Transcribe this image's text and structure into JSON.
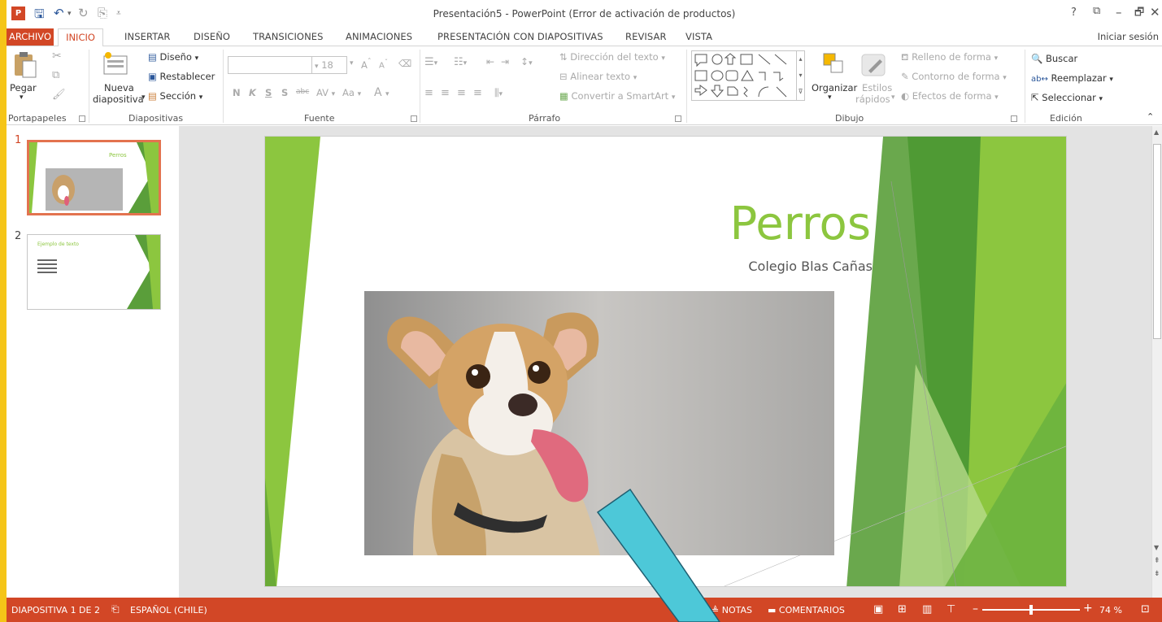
{
  "window": {
    "title": "Presentación5 - PowerPoint (Error de activación de productos)",
    "app_badge": "P",
    "controls": [
      "?",
      "⧉",
      "–",
      "🗗",
      "✕"
    ]
  },
  "tabs": {
    "file": "ARCHIVO",
    "active": "INICIO",
    "items": [
      "INSERTAR",
      "DISEÑO",
      "TRANSICIONES",
      "ANIMACIONES",
      "PRESENTACIÓN CON DIAPOSITIVAS",
      "REVISAR",
      "VISTA"
    ],
    "signin": "Iniciar sesión"
  },
  "ribbon": {
    "clipboard": {
      "paste": "Pegar",
      "label": "Portapapeles"
    },
    "slides": {
      "new_slide_1": "Nueva",
      "new_slide_2": "diapositiva",
      "layout": "Diseño",
      "reset": "Restablecer",
      "section": "Sección",
      "label": "Diapositivas"
    },
    "font": {
      "size": "18",
      "bold": "N",
      "italic": "K",
      "underline": "S",
      "shadow": "S",
      "strike": "abc",
      "spacing": "AV",
      "case": "Aa",
      "color": "A",
      "grow": "A",
      "shrink": "A",
      "label": "Fuente"
    },
    "paragraph": {
      "direction": "Dirección del texto",
      "align": "Alinear texto",
      "smartart": "Convertir a SmartArt",
      "label": "Párrafo"
    },
    "drawing": {
      "arrange": "Organizar",
      "styles_1": "Estilos",
      "styles_2": "rápidos",
      "fill": "Relleno de forma",
      "outline": "Contorno de forma",
      "effects": "Efectos de forma",
      "label": "Dibujo"
    },
    "editing": {
      "find": "Buscar",
      "replace": "Reemplazar",
      "select": "Seleccionar",
      "label": "Edición"
    }
  },
  "thumbnails": [
    {
      "number": "1",
      "title": "Perros",
      "selected": true
    },
    {
      "number": "2",
      "title": "Ejemplo de texto",
      "selected": false
    }
  ],
  "slide": {
    "title": "Perros",
    "subtitle": "Colegio Blas Cañas"
  },
  "status": {
    "slide_info": "DIAPOSITIVA 1 DE 2",
    "language": "ESPAÑOL (CHILE)",
    "notes": "NOTAS",
    "comments": "COMENTARIOS",
    "zoom": "74 %"
  },
  "colors": {
    "accent": "#d24726",
    "slide_green": "#8cc63f",
    "arrow": "#4dc8d8",
    "desktop": "#f5c518"
  }
}
